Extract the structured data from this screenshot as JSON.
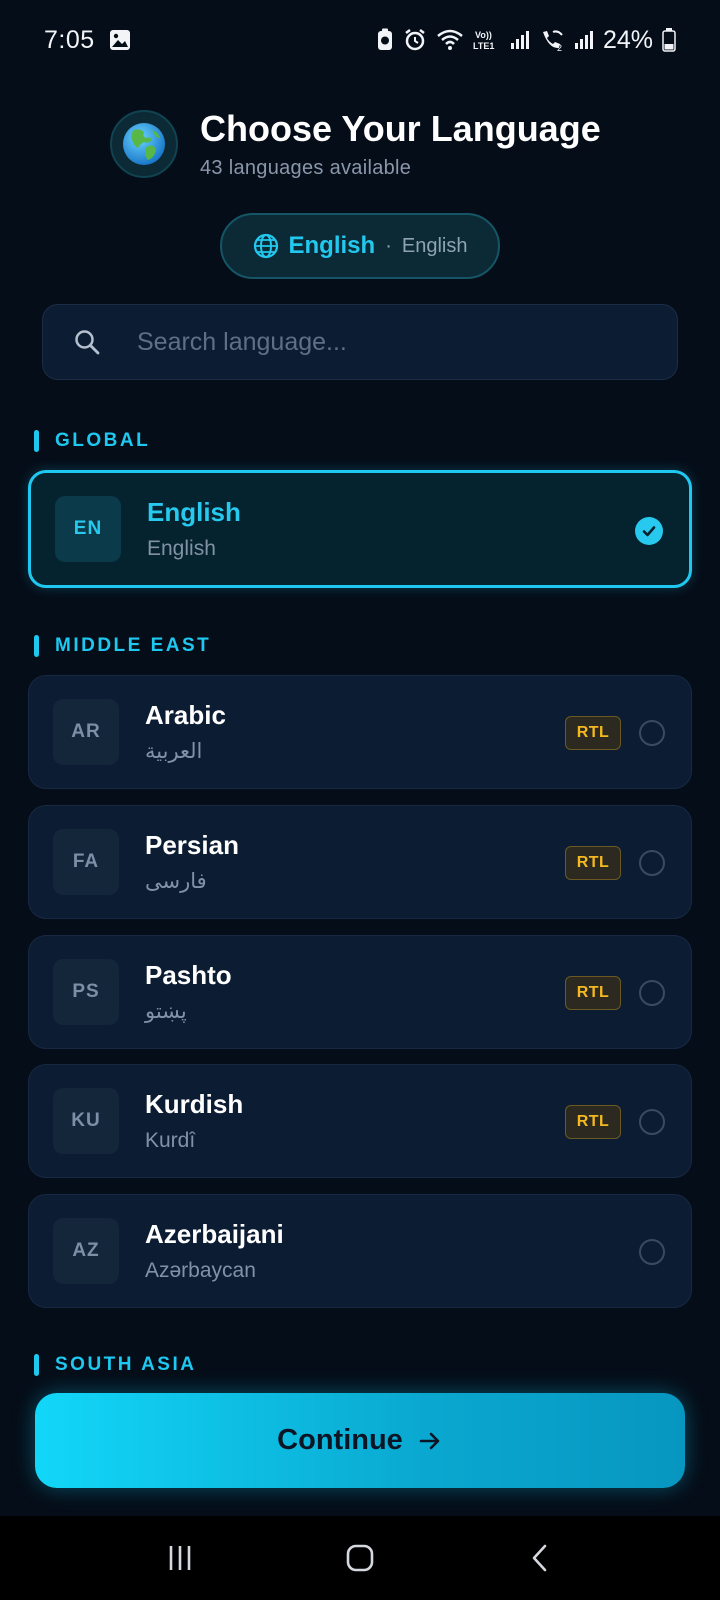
{
  "status_bar": {
    "time": "7:05",
    "battery": "24%",
    "icons": [
      "gallery-icon",
      "battery-saver-icon",
      "alarm-icon",
      "wifi-icon",
      "volte-icon",
      "signal-icon",
      "wifi-calling-icon",
      "signal-icon",
      "battery-icon"
    ]
  },
  "header": {
    "title": "Choose Your Language",
    "subtitle": "43 languages available",
    "icon": "globe-emoji-icon"
  },
  "current_language": {
    "icon": "globe-icon",
    "name": "English",
    "native": "English",
    "separator": "·"
  },
  "search": {
    "placeholder": "Search language...",
    "value": "",
    "icon": "search-icon"
  },
  "sections": [
    {
      "label": "GLOBAL",
      "languages": [
        {
          "code": "EN",
          "name": "English",
          "native": "English",
          "rtl": false,
          "selected": true
        }
      ]
    },
    {
      "label": "MIDDLE EAST",
      "languages": [
        {
          "code": "AR",
          "name": "Arabic",
          "native": "العربية",
          "rtl": true,
          "selected": false
        },
        {
          "code": "FA",
          "name": "Persian",
          "native": "فارسی",
          "rtl": true,
          "selected": false
        },
        {
          "code": "PS",
          "name": "Pashto",
          "native": "پښتو",
          "rtl": true,
          "selected": false
        },
        {
          "code": "KU",
          "name": "Kurdish",
          "native": "Kurdî",
          "rtl": true,
          "selected": false
        },
        {
          "code": "AZ",
          "name": "Azerbaijani",
          "native": "Azərbaycan",
          "rtl": false,
          "selected": false
        }
      ]
    },
    {
      "label": "SOUTH ASIA",
      "languages": []
    }
  ],
  "rtl_label": "RTL",
  "continue_button": {
    "label": "Continue",
    "icon": "arrow-right-icon"
  },
  "nav_bar": {
    "buttons": [
      "recent-apps-icon",
      "home-icon",
      "back-icon"
    ]
  },
  "colors": {
    "background": "#050d18",
    "accent": "#1ec8f0",
    "card": "#0c1c33",
    "rtl": "#f5b81e"
  }
}
